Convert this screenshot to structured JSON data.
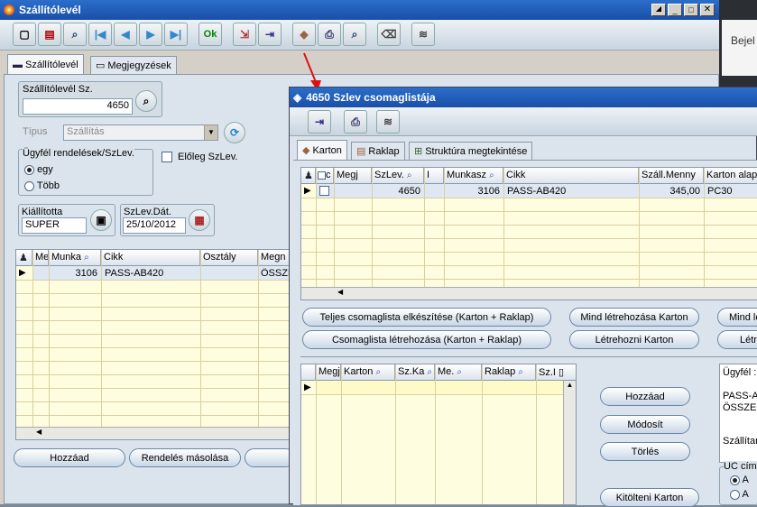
{
  "main_window": {
    "title": "Szállítólevél",
    "tabs": [
      {
        "label": "Szállítólevél"
      },
      {
        "label": "Megjegyzések"
      }
    ],
    "form": {
      "szlev_label": "Szállítólevél Sz.",
      "szlev_value": "4650",
      "tipus_label": "Típus",
      "tipus_value": "Szállítás",
      "ugyfel_group": "Ügyfél rendelések/SzLev.",
      "radio_egy": "egy",
      "radio_tobb": "Több",
      "eloleg_label": "Előleg SzLev.",
      "kiallitotta_label": "Kiállította",
      "kiallitotta_value": "SUPER",
      "datum_label": "SzLev.Dát.",
      "datum_value": "25/10/2012"
    },
    "grid": {
      "headers": {
        "megj": "Me",
        "munka": "Munka",
        "cikk": "Cikk",
        "osztaly": "Osztály",
        "megn": "Megn"
      },
      "row": {
        "munka": "3106",
        "cikk": "PASS-AB420",
        "megn": "ÖSSZE"
      }
    },
    "buttons": {
      "hozzaad": "Hozzáad",
      "rendeles_masolasa": "Rendelés másolása"
    }
  },
  "top_right": {
    "text": "Bejel"
  },
  "sub_window": {
    "title": "4650 Szlev csomaglistája",
    "tabs": [
      {
        "label": "Karton"
      },
      {
        "label": "Raklap"
      },
      {
        "label": "Struktúra megtekintése"
      }
    ],
    "top_grid": {
      "headers": {
        "c": "c",
        "megj": "Megj",
        "szlev": "SzLev.",
        "i": "I",
        "munkasz": "Munkasz",
        "cikk": "Cikk",
        "szall_menny": "Száll.Menny",
        "karton_alap": "Karton alap"
      },
      "row": {
        "szlev": "4650",
        "munkasz": "3106",
        "cikk": "PASS-AB420",
        "szall_menny": "345,00",
        "karton_alap": "PC30"
      }
    },
    "buttons": {
      "teljes": "Teljes csomaglista elkészítése (Karton + Raklap)",
      "csomaglista": "Csomaglista létrehozása (Karton + Raklap)",
      "mind_karton": "Mind létrehozása Karton",
      "letrehozni_karton": "Létrehozni Karton",
      "mind_cut": "Mind lét",
      "letre_cut": "Létr",
      "hozzaad": "Hozzáad",
      "modosit": "Módosít",
      "torles": "Törlés",
      "kitolteni": "Kitölteni Karton"
    },
    "bottom_grid": {
      "headers": {
        "megj": "Megj",
        "karton": "Karton",
        "szka": "Sz.Ka",
        "me": "Me.",
        "raklap": "Raklap",
        "szi": "Sz.I"
      }
    },
    "right_panel": {
      "ugyfel": "Ügyfél :(",
      "line1": "PASS-A",
      "line2": "ÖSSZEN",
      "szallitan": "Szállítan",
      "uc_cim": "UC címl",
      "opt_a": "A"
    }
  }
}
